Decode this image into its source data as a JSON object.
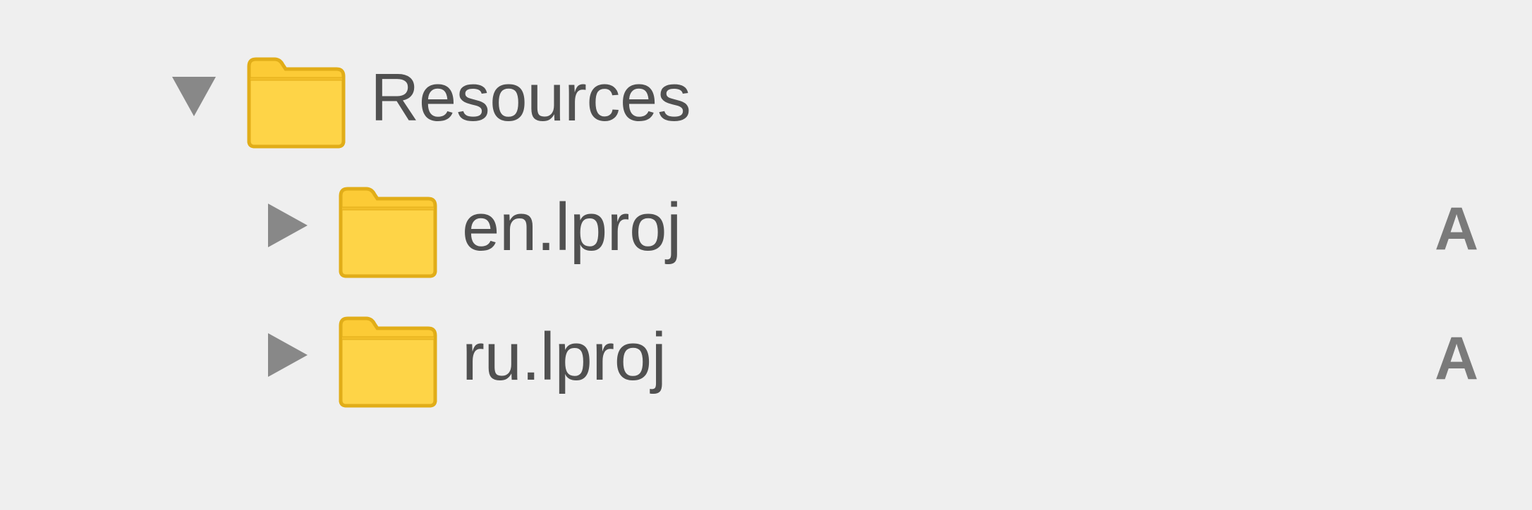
{
  "navigator": {
    "items": [
      {
        "label": "Resources",
        "expanded": true,
        "level": 0,
        "icon": "folder-icon",
        "status": ""
      },
      {
        "label": "en.lproj",
        "expanded": false,
        "level": 1,
        "icon": "folder-icon",
        "status": "A"
      },
      {
        "label": "ru.lproj",
        "expanded": false,
        "level": 1,
        "icon": "folder-icon",
        "status": "A"
      }
    ]
  },
  "colors": {
    "background": "#efefef",
    "folder_fill": "#fdcb3a",
    "folder_border": "#e1ad18",
    "text": "#505050",
    "disclosure": "#888888",
    "status": "#7a7a7a"
  }
}
